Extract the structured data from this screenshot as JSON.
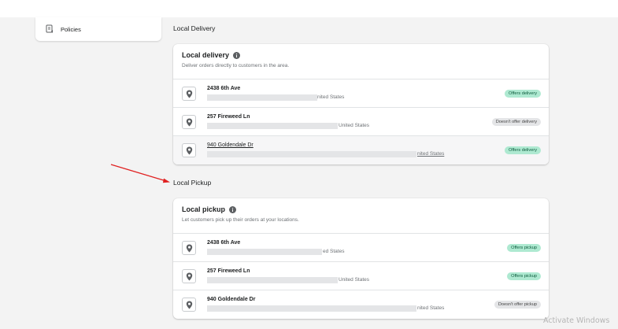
{
  "nav": {
    "policies_label": "Policies"
  },
  "delivery": {
    "section_title": "Local Delivery",
    "card_title": "Local delivery",
    "card_subtitle": "Deliver orders directly to customers in the area.",
    "rows": [
      {
        "address": "2438 6th Ave",
        "country_fragment": "nited States",
        "status": "Offers delivery",
        "available": true
      },
      {
        "address": "257 Fireweed Ln",
        "country_fragment": "United States",
        "status": "Doesn't offer delivery",
        "available": false
      },
      {
        "address": "940 Goldendale Dr",
        "country_fragment": "nited States",
        "status": "Offers delivery",
        "available": true
      }
    ]
  },
  "pickup": {
    "section_title": "Local Pickup",
    "card_title": "Local pickup",
    "card_subtitle": "Let customers pick up their orders at your locations.",
    "rows": [
      {
        "address": "2438 6th Ave",
        "country_fragment": "ed States",
        "status": "Offers pickup",
        "available": true
      },
      {
        "address": "257 Fireweed Ln",
        "country_fragment": "United States",
        "status": "Offers pickup",
        "available": true
      },
      {
        "address": "940 Goldendale Dr",
        "country_fragment": "nited States",
        "status": "Doesn't offer pickup",
        "available": false
      }
    ]
  },
  "watermark": "Activate Windows",
  "colors": {
    "badge_on": "#aee9d1",
    "badge_off": "#e4e5e7",
    "arrow": "#e02020"
  },
  "icons": {
    "nav": "policies-document-icon",
    "info": "info-circle-icon",
    "location": "location-pin-icon"
  }
}
